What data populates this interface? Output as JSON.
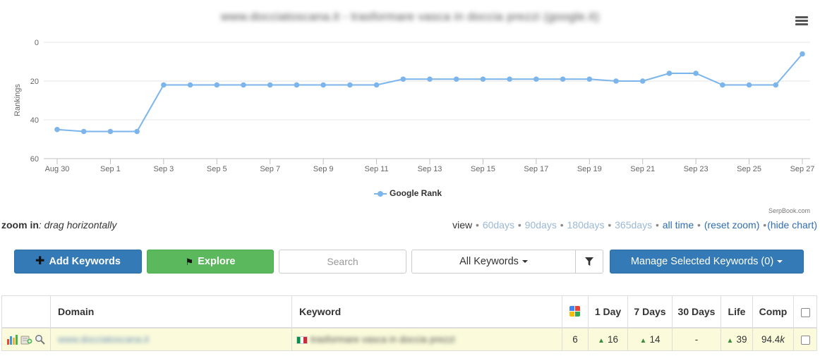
{
  "chart": {
    "title": "www.docciatoscana.it - trasformare vasca in doccia prezzi (google.it)",
    "menu_icon": "hamburger-menu-icon",
    "credits": "SerpBook.com"
  },
  "chart_data": {
    "type": "line",
    "title": "www.docciatoscana.it - trasformare vasca in doccia prezzi (google.it)",
    "ylabel": "Rankings",
    "xlabel": "",
    "y_reversed": true,
    "ylim": [
      0,
      60
    ],
    "y_ticks": [
      "0",
      "20",
      "40",
      "60"
    ],
    "x_tick_labels": [
      "Aug 30",
      "Sep 1",
      "Sep 3",
      "Sep 5",
      "Sep 7",
      "Sep 9",
      "Sep 11",
      "Sep 13",
      "Sep 15",
      "Sep 17",
      "Sep 19",
      "Sep 21",
      "Sep 23",
      "Sep 25",
      "Sep 27"
    ],
    "x": [
      "Aug 30",
      "Aug 31",
      "Sep 1",
      "Sep 2",
      "Sep 3",
      "Sep 4",
      "Sep 5",
      "Sep 6",
      "Sep 7",
      "Sep 8",
      "Sep 9",
      "Sep 10",
      "Sep 11",
      "Sep 12",
      "Sep 13",
      "Sep 14",
      "Sep 15",
      "Sep 16",
      "Sep 17",
      "Sep 18",
      "Sep 19",
      "Sep 20",
      "Sep 21",
      "Sep 22",
      "Sep 23",
      "Sep 24",
      "Sep 25",
      "Sep 26",
      "Sep 27"
    ],
    "series": [
      {
        "name": "Google Rank",
        "color": "#7cb5ec",
        "values": [
          45,
          46,
          46,
          46,
          22,
          22,
          22,
          22,
          22,
          22,
          22,
          22,
          22,
          19,
          19,
          19,
          19,
          19,
          19,
          19,
          19,
          20,
          20,
          16,
          16,
          22,
          22,
          22,
          6
        ]
      }
    ],
    "grid": true,
    "legend": "bottom-center"
  },
  "zoom": {
    "label": "zoom in",
    "hint": ": drag horizontally"
  },
  "view": {
    "label": "view",
    "links": [
      {
        "text": "60days",
        "active": false
      },
      {
        "text": "90days",
        "active": false
      },
      {
        "text": "180days",
        "active": false
      },
      {
        "text": "365days",
        "active": false
      },
      {
        "text": "all time",
        "active": true
      },
      {
        "text": "(reset zoom)",
        "active": true
      },
      {
        "text": "(hide chart)",
        "active": true
      }
    ]
  },
  "toolbar": {
    "add_label": "Add Keywords",
    "explore_label": "Explore",
    "search_placeholder": "Search",
    "filter_select": "All Keywords",
    "manage_label": "Manage Selected Keywords (0)"
  },
  "table": {
    "headers": {
      "domain": "Domain",
      "keyword": "Keyword",
      "day1": "1 Day",
      "day7": "7 Days",
      "day30": "30 Days",
      "life": "Life",
      "comp": "Comp"
    },
    "rows": [
      {
        "domain": "www.docciatoscana.it",
        "keyword": "trasformare vasca in doccia prezzi",
        "rank": "6",
        "day1": "16",
        "day7": "14",
        "day30": "-",
        "life": "39",
        "comp_num": "94.4",
        "comp_unit": "k"
      }
    ]
  },
  "colors": {
    "series": "#7cb5ec",
    "primary": "#337ab7",
    "success": "#5cb85c",
    "highlight_row": "#fbfbdc"
  }
}
